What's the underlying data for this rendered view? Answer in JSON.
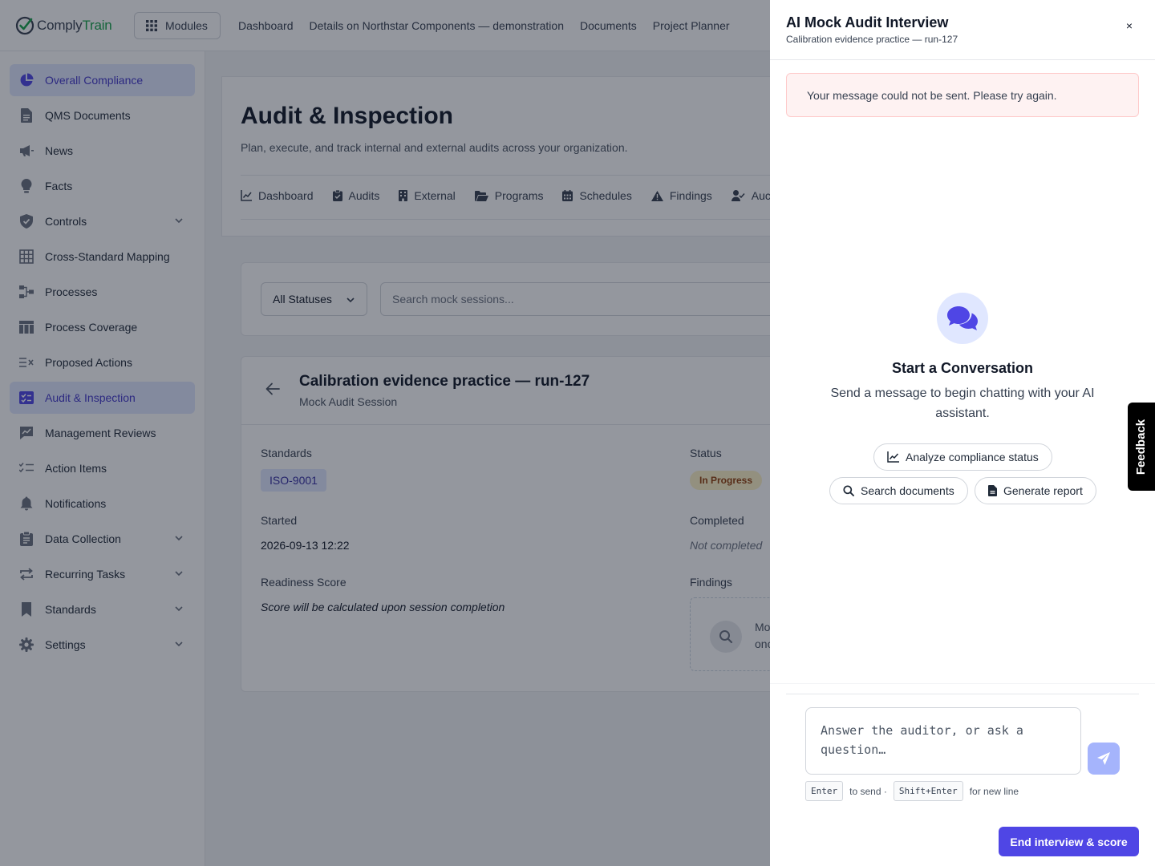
{
  "topbar": {
    "logo_part1": "Comply",
    "logo_part2": "Train",
    "modules_label": "Modules",
    "nav": [
      "Dashboard",
      "Details on Northstar Components — demonstration",
      "Documents",
      "Project Planner"
    ]
  },
  "sidebar": {
    "items": [
      {
        "label": "Overall Compliance",
        "icon": "pie-chart-icon",
        "active": true
      },
      {
        "label": "QMS Documents",
        "icon": "document-icon"
      },
      {
        "label": "News",
        "icon": "megaphone-icon"
      },
      {
        "label": "Facts",
        "icon": "lightbulb-icon"
      },
      {
        "label": "Controls",
        "icon": "shield-icon",
        "expandable": true
      },
      {
        "label": "Cross-Standard Mapping",
        "icon": "grid-icon"
      },
      {
        "label": "Processes",
        "icon": "flow-icon"
      },
      {
        "label": "Process Coverage",
        "icon": "table-icon"
      },
      {
        "label": "Proposed Actions",
        "icon": "list-x-icon"
      },
      {
        "label": "Audit & Inspection",
        "icon": "checklist-icon",
        "active": true
      },
      {
        "label": "Management Reviews",
        "icon": "chart-comment-icon"
      },
      {
        "label": "Action Items",
        "icon": "tasks-icon"
      },
      {
        "label": "Notifications",
        "icon": "bell-icon"
      },
      {
        "label": "Data Collection",
        "icon": "clipboard-icon",
        "expandable": true
      },
      {
        "label": "Recurring Tasks",
        "icon": "repeat-icon",
        "expandable": true
      },
      {
        "label": "Standards",
        "icon": "bookmark-icon",
        "expandable": true
      },
      {
        "label": "Settings",
        "icon": "gear-icon",
        "expandable": true
      }
    ]
  },
  "main": {
    "title": "Audit & Inspection",
    "subtitle": "Plan, execute, and track internal and external audits across your organization.",
    "tabs": [
      {
        "label": "Dashboard",
        "icon": "chart-line-icon"
      },
      {
        "label": "Audits",
        "icon": "clipboard-check-icon"
      },
      {
        "label": "External",
        "icon": "building-icon"
      },
      {
        "label": "Programs",
        "icon": "folder-open-icon"
      },
      {
        "label": "Schedules",
        "icon": "calendar-icon"
      },
      {
        "label": "Findings",
        "icon": "warning-icon"
      },
      {
        "label": "Auc",
        "icon": "user-check-icon"
      }
    ],
    "filter": {
      "status_value": "All Statuses",
      "search_placeholder": "Search mock sessions..."
    },
    "session": {
      "title": "Calibration evidence practice — run-127",
      "subtitle": "Mock Audit Session",
      "standards_label": "Standards",
      "standard_badge": "ISO-9001",
      "status_label": "Status",
      "status_value": "In Progress",
      "started_label": "Started",
      "started_value": "2026-09-13 12:22",
      "completed_label": "Completed",
      "completed_value": "Not completed",
      "readiness_label": "Readiness Score",
      "readiness_value": "Score will be calculated upon session completion",
      "findings_label": "Findings",
      "findings_text_line1": "Mo",
      "findings_text_line2": "onc"
    }
  },
  "drawer": {
    "title": "AI Mock Audit Interview",
    "subtitle": "Calibration evidence practice — run-127",
    "close_label": "×",
    "error": "Your message could not be sent. Please try again.",
    "empty_title": "Start a Conversation",
    "empty_desc": "Send a message to begin chatting with your AI assistant.",
    "chips": [
      {
        "label": "Analyze compliance status",
        "icon": "chart-line-icon"
      },
      {
        "label": "Search documents",
        "icon": "search-icon"
      },
      {
        "label": "Generate report",
        "icon": "file-icon"
      }
    ],
    "composer_placeholder": "Answer the auditor, or ask a question…",
    "hint_key1": "Enter",
    "hint_text1": "to send ·",
    "hint_key2": "Shift+Enter",
    "hint_text2": "for new line",
    "end_button": "End interview & score"
  },
  "feedback": {
    "label": "Feedback"
  },
  "colors": {
    "accent": "#4f46e5",
    "active_bg": "#e0e7ff",
    "error_bg": "#fef2f2",
    "status_badge_bg": "#fef3c7"
  }
}
